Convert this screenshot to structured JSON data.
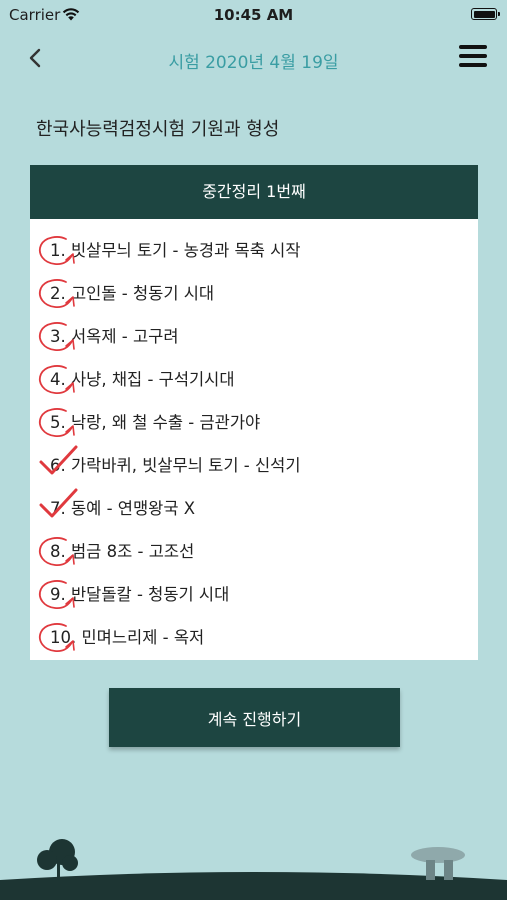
{
  "status_bar": {
    "carrier": "Carrier",
    "time": "10:45 AM"
  },
  "nav": {
    "title": "시험 2020년 4월 19일"
  },
  "section_title": "한국사능력검정시험 기원과 형성",
  "card": {
    "header": "중간정리 1번째",
    "items": [
      {
        "text": "1. 빗살무늬 토기 - 농경과 목축 시작",
        "mark": "circle"
      },
      {
        "text": "2. 고인돌 - 청동기 시대",
        "mark": "circle"
      },
      {
        "text": "3. 서옥제 - 고구려",
        "mark": "circle"
      },
      {
        "text": "4. 사냥, 채집 - 구석기시대",
        "mark": "circle"
      },
      {
        "text": "5. 낙랑, 왜 철 수출 - 금관가야",
        "mark": "circle"
      },
      {
        "text": "6. 가락바퀴, 빗살무늬 토기 - 신석기",
        "mark": "check"
      },
      {
        "text": "7. 동예 - 연맹왕국 X",
        "mark": "check"
      },
      {
        "text": "8. 범금 8조 - 고조선",
        "mark": "circle"
      },
      {
        "text": "9. 반달돌칼 - 청동기 시대",
        "mark": "circle"
      },
      {
        "text": "10. 민며느리제 - 옥저",
        "mark": "circle"
      }
    ]
  },
  "continue_button": "계속 진행하기",
  "colors": {
    "background": "#b6dbdc",
    "dark_green": "#1d4541",
    "title_teal": "#3a9da3",
    "mark_red": "#e0393e"
  },
  "icons": {
    "back": "chevron-left-icon",
    "menu": "hamburger-menu-icon",
    "wifi": "wifi-icon",
    "battery": "battery-icon"
  }
}
